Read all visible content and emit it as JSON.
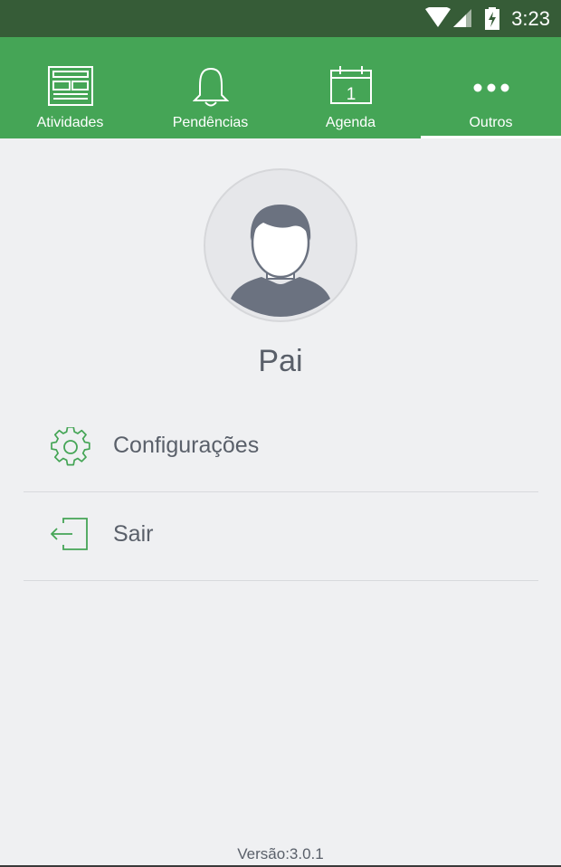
{
  "status_bar": {
    "time": "3:23",
    "icons": [
      "wifi-icon",
      "signal-icon",
      "battery-charging-icon"
    ]
  },
  "tabs": [
    {
      "label": "Atividades",
      "icon": "newspaper-icon",
      "active": false
    },
    {
      "label": "Pendências",
      "icon": "bell-icon",
      "active": false
    },
    {
      "label": "Agenda",
      "icon": "calendar-icon",
      "calendar_day": "1",
      "active": false
    },
    {
      "label": "Outros",
      "icon": "more-dots-icon",
      "active": true
    }
  ],
  "profile": {
    "name": "Pai",
    "avatar_icon": "user-avatar-icon"
  },
  "menu": [
    {
      "label": "Configurações",
      "icon": "gear-icon"
    },
    {
      "label": "Sair",
      "icon": "logout-icon"
    }
  ],
  "footer": {
    "version": "Versão:3.0.1"
  },
  "colors": {
    "status_bar": "#365c37",
    "tab_bar": "#45a556",
    "accent_icon": "#45a556",
    "background": "#eff0f2",
    "text": "#5a606a"
  }
}
